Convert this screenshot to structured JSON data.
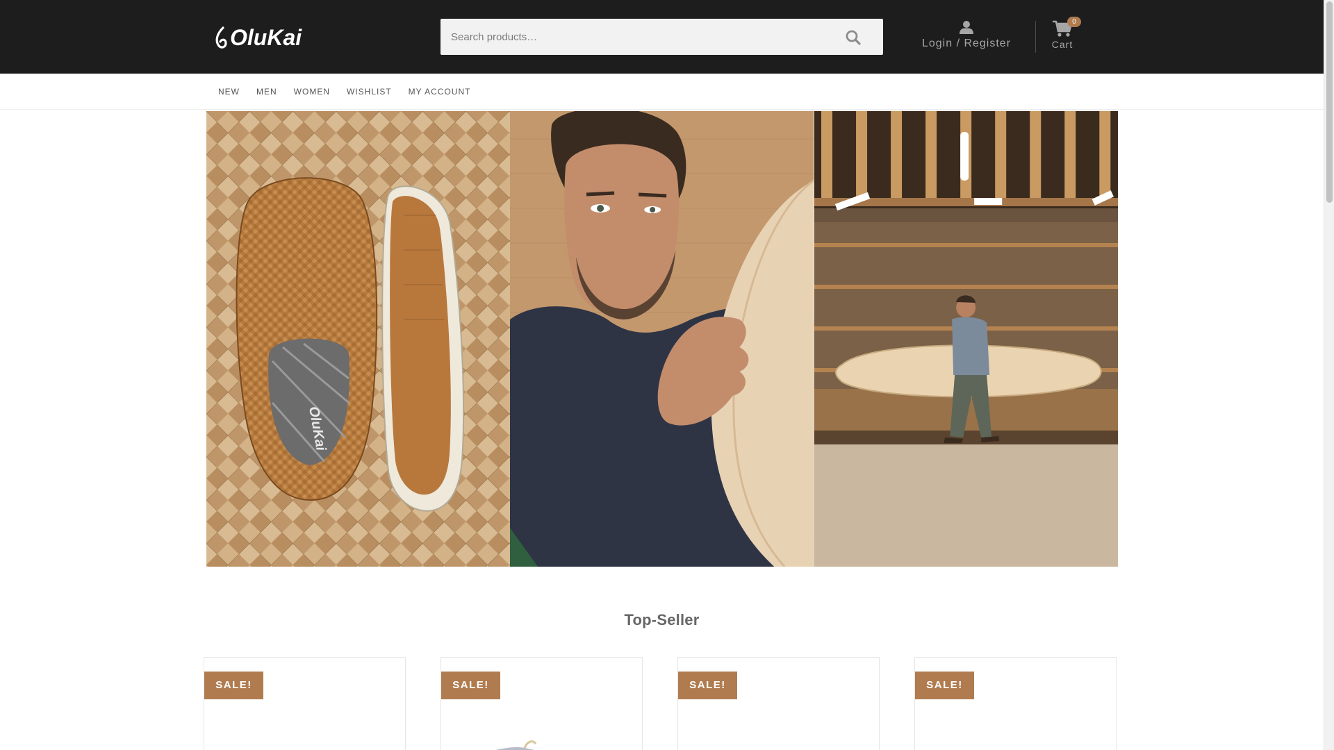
{
  "header": {
    "logo_text": "OluKai",
    "search_placeholder": "Search products…",
    "account_label": "Login / Register",
    "cart_label": "Cart",
    "cart_count": "0"
  },
  "nav": {
    "items": [
      {
        "label": "NEW"
      },
      {
        "label": "MEN"
      },
      {
        "label": "WOMEN"
      },
      {
        "label": "WISHLIST"
      },
      {
        "label": "MY ACCOUNT"
      }
    ]
  },
  "hero": {
    "panels": [
      "woven-leather-slip-on-shoe",
      "man-holding-surfboard-closeup",
      "man-walking-with-surfboard-workshop"
    ],
    "insole_logo": "OluKai"
  },
  "section": {
    "title": "Top-Seller"
  },
  "products": [
    {
      "badge": "SALE!"
    },
    {
      "badge": "SALE!"
    },
    {
      "badge": "SALE!"
    },
    {
      "badge": "SALE!"
    }
  ],
  "colors": {
    "header_bg": "#1d1d1d",
    "accent": "#b07c4f",
    "search_bg": "#f2f2f2"
  }
}
